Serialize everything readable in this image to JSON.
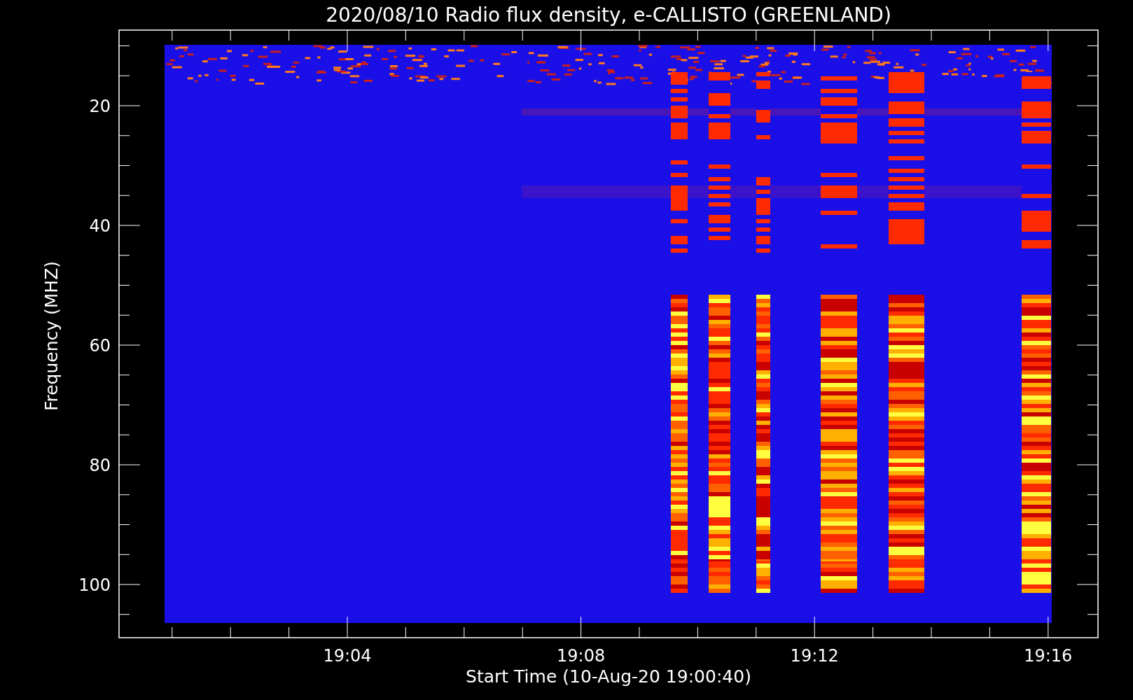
{
  "title": "2020/08/10  Radio flux density, e-CALLISTO (GREENLAND)",
  "y_axis": {
    "label": "Frequency (MHZ)",
    "tick_labels": [
      "20",
      "40",
      "60",
      "80",
      "100"
    ]
  },
  "x_axis": {
    "label": "Start Time (10-Aug-20 19:00:40)",
    "tick_labels": [
      "19:04",
      "19:08",
      "19:12",
      "19:16"
    ]
  }
}
